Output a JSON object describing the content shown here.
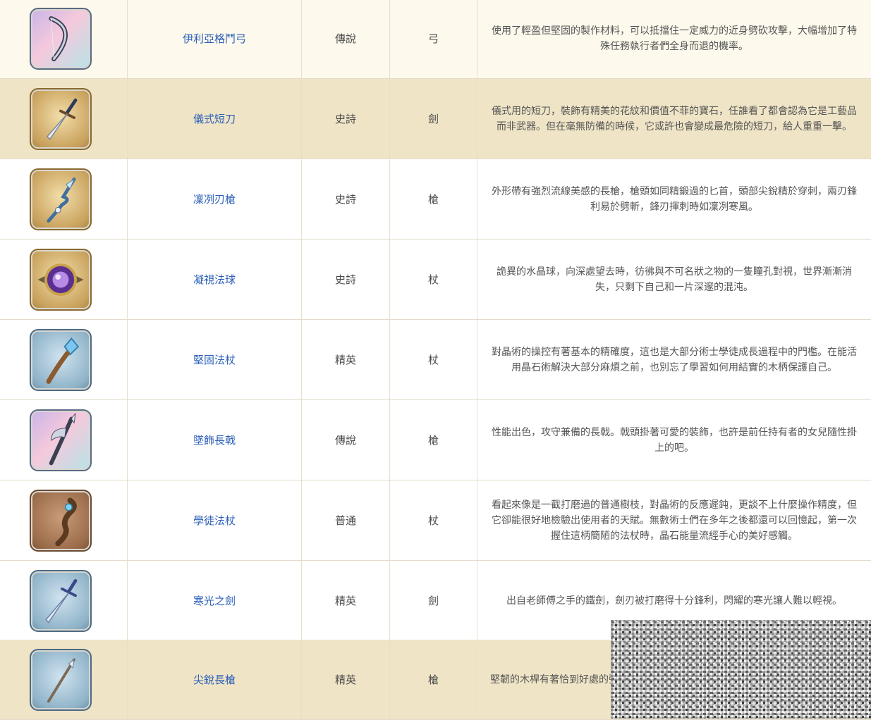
{
  "rows": [
    {
      "icon": "bow-icon",
      "name": "伊利亞格鬥弓",
      "rarity": "傳說",
      "type": "弓",
      "description": "使用了輕盈但堅固的製作材料，可以抵擋住一定威力的近身劈砍攻擊，大幅增加了特殊任務執行者們全身而退的機率。"
    },
    {
      "icon": "dagger-icon",
      "name": "儀式短刀",
      "rarity": "史詩",
      "type": "劍",
      "description": "儀式用的短刀，裝飾有精美的花紋和價值不菲的寶石，任誰看了都會認為它是工藝品而非武器。但在毫無防備的時候，它或許也會變成最危險的短刀，給人重重一擊。"
    },
    {
      "icon": "spear-icon",
      "name": "凜冽刃槍",
      "rarity": "史詩",
      "type": "槍",
      "description": "外形帶有強烈流線美感的長槍，槍頭如同精鍛過的匕首，頭部尖銳精於穿刺，兩刃鋒利易於劈斬，鋒刃揮刺時如凜冽寒風。"
    },
    {
      "icon": "orb-icon",
      "name": "凝視法球",
      "rarity": "史詩",
      "type": "杖",
      "description": "詭異的水晶球，向深處望去時，彷彿與不可名狀之物的一隻瞳孔對視，世界漸漸消失，只剩下自己和一片深邃的混沌。"
    },
    {
      "icon": "staff-icon",
      "name": "堅固法杖",
      "rarity": "精英",
      "type": "杖",
      "description": "對晶術的操控有著基本的精確度，這也是大部分術士學徒成長過程中的門檻。在能活用晶石術解決大部分麻煩之前，也別忘了學習如何用結實的木柄保護自己。"
    },
    {
      "icon": "halberd-icon",
      "name": "墜飾長戟",
      "rarity": "傳說",
      "type": "槍",
      "description": "性能出色，攻守兼備的長戟。戟頭掛著可愛的裝飾，也許是前任持有者的女兒隨性掛上的吧。"
    },
    {
      "icon": "wooden-staff-icon",
      "name": "學徒法杖",
      "rarity": "普通",
      "type": "杖",
      "description": "看起來像是一截打磨過的普通樹枝，對晶術的反應遲鈍，更談不上什麼操作精度，但它卻能很好地檢驗出使用者的天賦。無數術士們在多年之後都還可以回憶起，第一次握住這柄簡陋的法杖時，晶石能量流經手心的美好感觸。"
    },
    {
      "icon": "sword-icon",
      "name": "寒光之劍",
      "rarity": "精英",
      "type": "劍",
      "description": "出自老師傅之手的鐵劍，劍刃被打磨得十分鋒利，閃耀的寒光讓人難以輕視。"
    },
    {
      "icon": "long-spear-icon",
      "name": "尖銳長槍",
      "rarity": "精英",
      "type": "槍",
      "description": "堅韌的木桿有著恰到好處的彈性，也絕不會有木刺扎到手裡，長槍的鋒利的"
    }
  ]
}
